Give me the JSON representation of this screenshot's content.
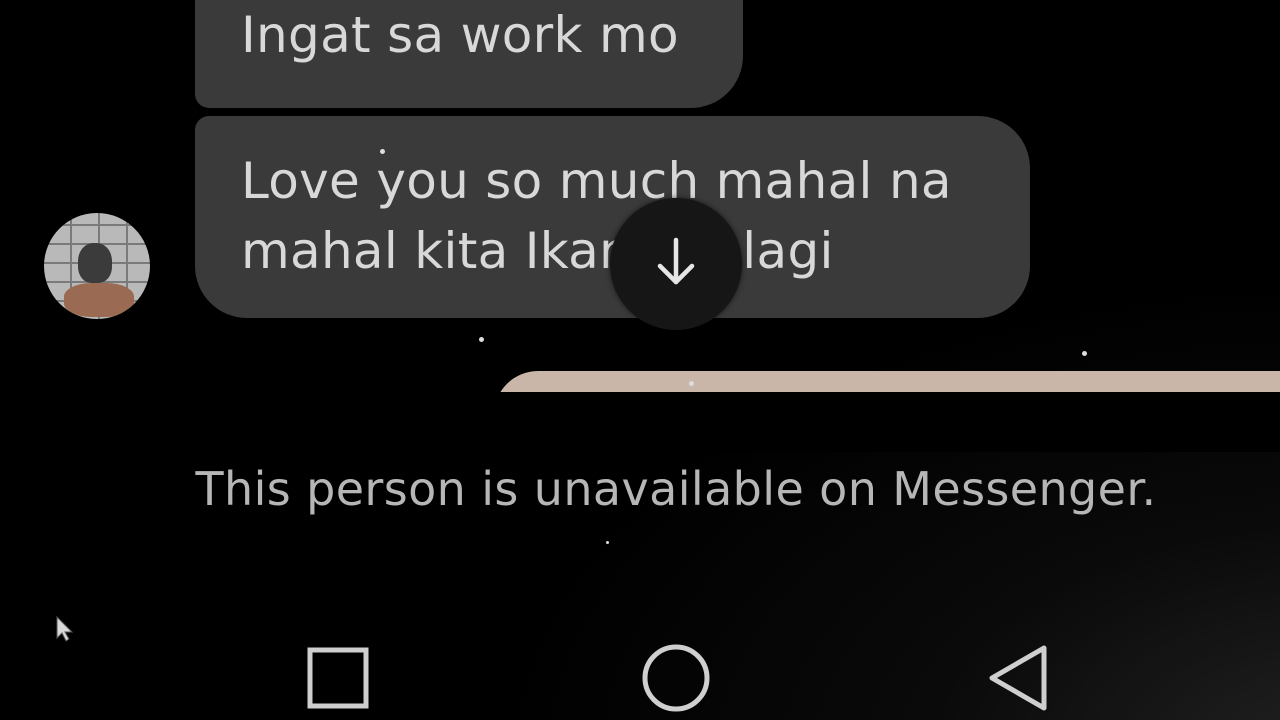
{
  "messages": [
    {
      "text": "Ingat sa work mo"
    },
    {
      "text": "Love you so much mahal na mahal kita Ika",
      "text_tail": "ng palagi"
    }
  ],
  "status": {
    "unavailable_text": "This person is unavailable on Messenger."
  },
  "icons": {
    "scroll_down": "arrow-down-icon",
    "nav_recents": "square-icon",
    "nav_home": "circle-icon",
    "nav_back": "triangle-back-icon"
  },
  "colors": {
    "bubble": "#3a3a3a",
    "bubble_text": "#d8d8d8",
    "status_text": "#b6b6b6",
    "background": "#000000",
    "preview_card": "#c9b6a8"
  }
}
